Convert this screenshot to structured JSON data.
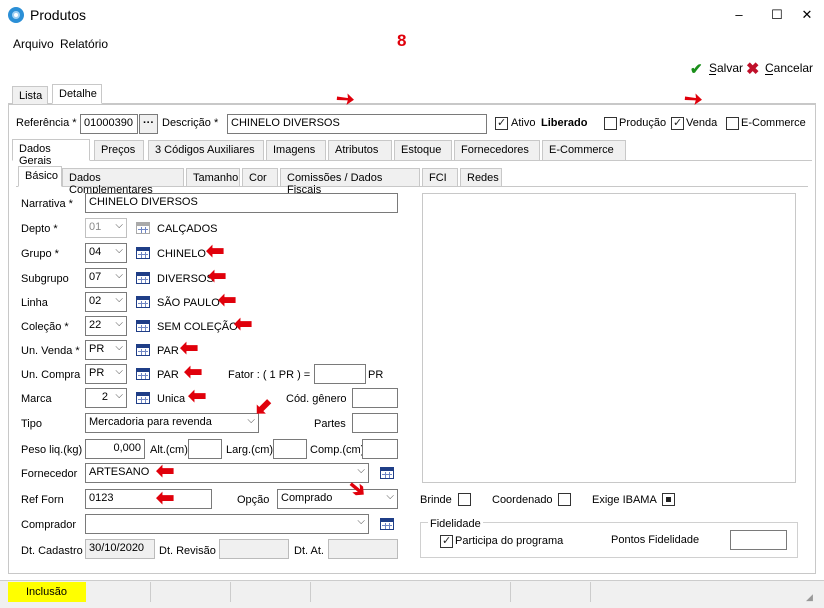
{
  "window": {
    "title": "Produtos",
    "min": "–",
    "max": "☐",
    "close": "✕"
  },
  "annotation": "8",
  "menu": [
    "Arquivo",
    "Relatório"
  ],
  "toolbar": {
    "save_label": "Salvar",
    "save_key": "S",
    "cancel_label": "Cancelar",
    "cancel_key": "C"
  },
  "view_tabs": [
    "Lista",
    "Detalhe"
  ],
  "header": {
    "referencia_label": "Referência *",
    "referencia_value": "01000390",
    "ellipsis": "···",
    "descricao_label": "Descrição *",
    "descricao_value": "CHINELO DIVERSOS",
    "ativo_label": "Ativo",
    "liberado_label": "Liberado",
    "producao_label": "Produção",
    "venda_label": "Venda",
    "ecommerce_label": "E-Commerce"
  },
  "main_tabs": [
    "Dados Gerais",
    "Preços",
    "3 Códigos Auxiliares",
    "Imagens",
    "Atributos",
    "Estoque",
    "Fornecedores",
    "E-Commerce"
  ],
  "sub_tabs": [
    "Básico",
    "Dados Complementares",
    "Tamanho",
    "Cor",
    "Comissões / Dados Fiscais",
    "FCI",
    "Redes"
  ],
  "form": {
    "narrativa_label": "Narrativa *",
    "narrativa_value": "CHINELO DIVERSOS",
    "depto_label": "Depto *",
    "depto_value": "01",
    "depto_desc": "CALÇADOS",
    "grupo_label": "Grupo *",
    "grupo_value": "04",
    "grupo_desc": "CHINELO",
    "subgrupo_label": "Subgrupo",
    "subgrupo_value": "07",
    "subgrupo_desc": "DIVERSOS",
    "linha_label": "Linha",
    "linha_value": "02",
    "linha_desc": "SÃO PAULO",
    "colecao_label": "Coleção *",
    "colecao_value": "22",
    "colecao_desc": "SEM COLEÇÃO",
    "unvenda_label": "Un. Venda *",
    "unvenda_value": "PR",
    "unvenda_desc": "PAR",
    "uncompra_label": "Un. Compra",
    "uncompra_value": "PR",
    "uncompra_desc": "PAR",
    "fator_label": "Fator : ( 1 PR ) =",
    "fator_unit": "PR",
    "marca_label": "Marca",
    "marca_value": "2",
    "marca_desc": "Unica",
    "codgenero_label": "Cód. gênero",
    "tipo_label": "Tipo",
    "tipo_value": "Mercadoria para revenda",
    "partes_label": "Partes",
    "peso_label": "Peso liq.(kg)",
    "peso_value": "0,000",
    "alt_label": "Alt.(cm)",
    "larg_label": "Larg.(cm)",
    "comp_label": "Comp.(cm)",
    "fornecedor_label": "Fornecedor",
    "fornecedor_value": "ARTESANO",
    "refforn_label": "Ref Forn",
    "refforn_value": "0123",
    "opcao_label": "Opção",
    "opcao_value": "Comprado",
    "comprador_label": "Comprador",
    "dtcadastro_label": "Dt. Cadastro",
    "dtcadastro_value": "30/10/2020",
    "dtrevisao_label": "Dt. Revisão",
    "dtat_label": "Dt. At."
  },
  "right": {
    "brinde_label": "Brinde",
    "coordenado_label": "Coordenado",
    "exige_ibama_label": "Exige IBAMA",
    "fidelidade_label": "Fidelidade",
    "participa_label": "Participa do programa",
    "pontos_label": "Pontos Fidelidade"
  },
  "status": {
    "mode": "Inclusão"
  },
  "colors": {
    "arrow": "#e0000b",
    "status_bg": "#ffff00"
  }
}
